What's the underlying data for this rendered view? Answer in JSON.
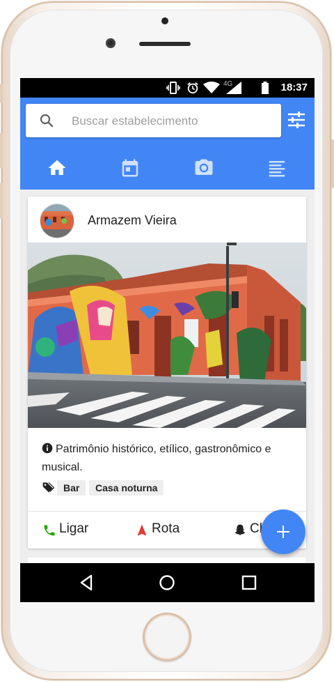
{
  "status_bar": {
    "network": "4G",
    "time": "18:37"
  },
  "search": {
    "placeholder": "Buscar estabelecimento"
  },
  "tabs": [
    {
      "name": "home",
      "icon": "home-icon"
    },
    {
      "name": "events",
      "icon": "calendar-icon"
    },
    {
      "name": "photos",
      "icon": "camera-icon"
    },
    {
      "name": "list",
      "icon": "list-icon"
    }
  ],
  "card": {
    "title": "Armazem Vieira",
    "description": "Patrimônio histórico, etílico, gastronômico e musical.",
    "tags": [
      "Bar",
      "Casa noturna"
    ],
    "actions": {
      "call": "Ligar",
      "route": "Rota",
      "checkin": "Check-in"
    }
  },
  "colors": {
    "primary": "#4286f5",
    "call_green": "#1faa00",
    "route_red": "#e53935"
  }
}
